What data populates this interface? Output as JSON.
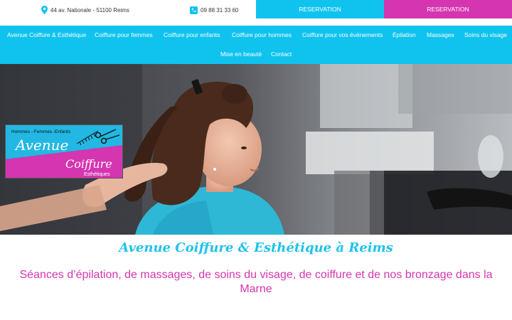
{
  "topbar": {
    "address": "44 av. Nationale - 51100 Reims",
    "phone": "09 88 31 33 60",
    "reservation_1": "RESERVATION",
    "reservation_2": "RESERVATION",
    "icons": {
      "address": "map-pin-icon",
      "phone": "phone-icon"
    }
  },
  "nav": {
    "items": [
      {
        "label": "Avenue Coiffure & Esthétique"
      },
      {
        "label": "Coiffure pour femmes"
      },
      {
        "label": "Coiffure pour enfants"
      },
      {
        "label": "Coiffure pour hommes"
      },
      {
        "label": "Coiffure pour vos événements"
      },
      {
        "label": "Épilation"
      },
      {
        "label": "Massages"
      },
      {
        "label": "Soins du visage"
      },
      {
        "label": "Mise en beauté"
      },
      {
        "label": "Contact"
      }
    ]
  },
  "logo": {
    "tagline": "Hommes - Femmes -Enfants",
    "word1": "Avenue",
    "word2": "Coiffure",
    "word3": "Esthétiques"
  },
  "main": {
    "title": "Avenue Coiffure & Esthétique à Reims",
    "subtitle": "Séances d’épilation, de massages, de soins du visage, de coiffure et de nos bronzage dans la Marne"
  },
  "colors": {
    "cyan": "#10c3ef",
    "magenta": "#d535b0",
    "title_cyan": "#1fc2ea"
  }
}
